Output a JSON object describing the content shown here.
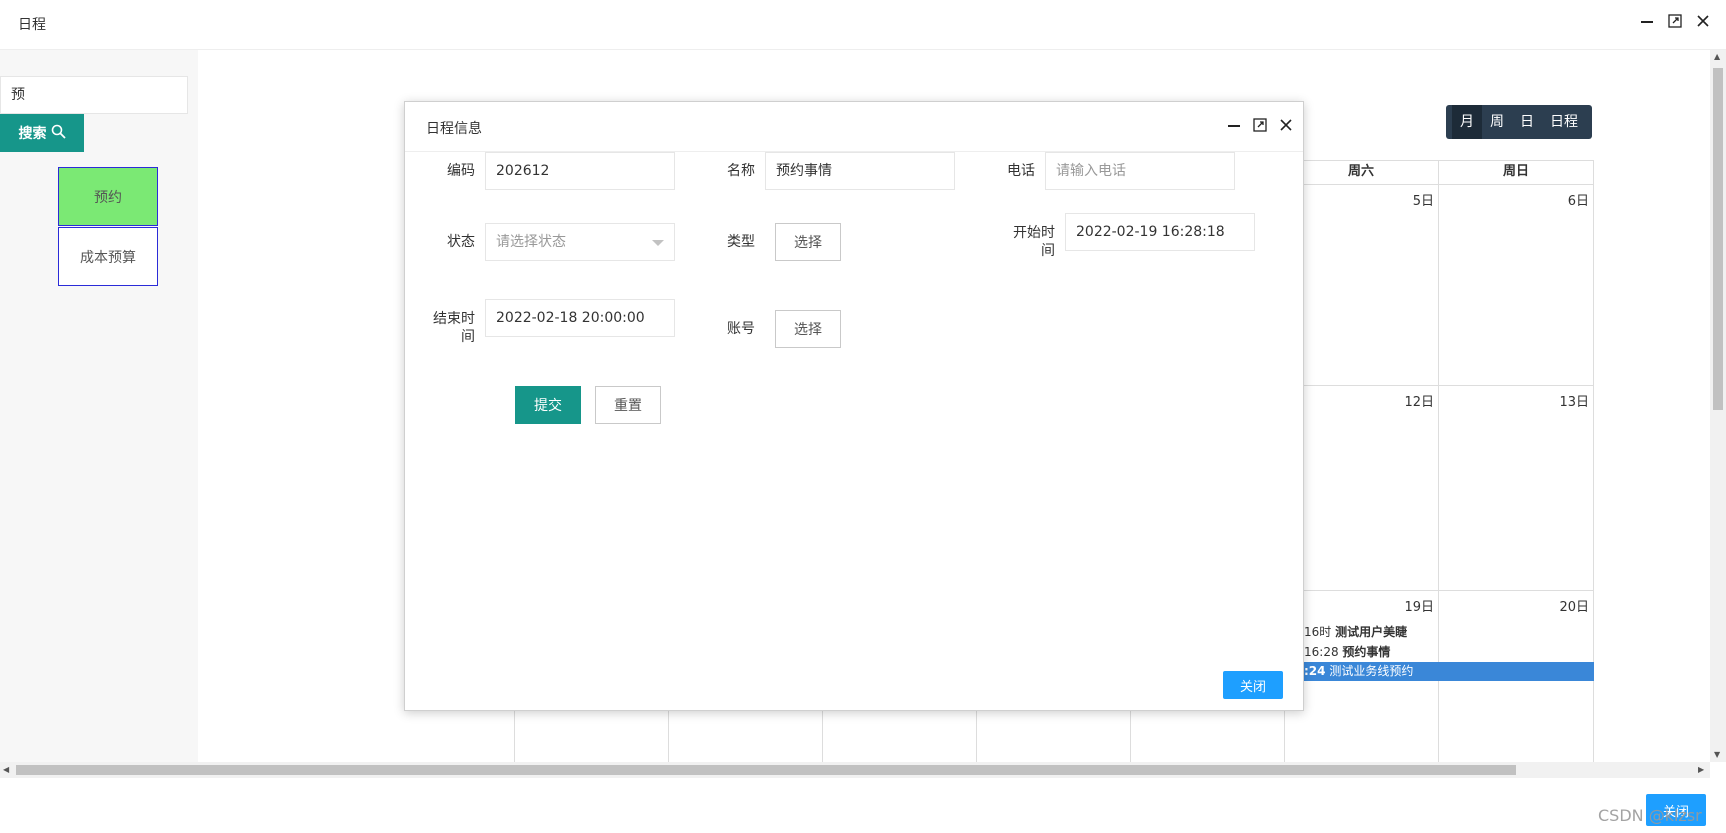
{
  "window": {
    "title": "日程"
  },
  "sidebar": {
    "search_value": "预",
    "search_button": "搜索",
    "categories": [
      {
        "label": "预约"
      },
      {
        "label": "成本预算"
      }
    ]
  },
  "calendar": {
    "views": [
      "月",
      "周",
      "日",
      "日程"
    ],
    "week_headers": [
      "周六",
      "周日"
    ],
    "day_numbers": [
      "5日",
      "6日",
      "12日",
      "13日",
      "19日",
      "20日"
    ],
    "events": [
      {
        "time": "16时",
        "title": "测试用户美睫"
      },
      {
        "time": "16:28",
        "title": "预约事情"
      },
      {
        "time": ":24",
        "title": "测试业务线预约"
      }
    ],
    "colors": {
      "event_bar": "#3a87d8",
      "view_switch": "#2c3e50"
    }
  },
  "dialog": {
    "title": "日程信息",
    "fields": {
      "code": {
        "label": "编码",
        "value": "202612"
      },
      "name": {
        "label": "名称",
        "value": "预约事情"
      },
      "phone": {
        "label": "电话",
        "placeholder": "请输入电话"
      },
      "status": {
        "label": "状态",
        "placeholder": "请选择状态"
      },
      "type": {
        "label": "类型",
        "button": "选择"
      },
      "start_time": {
        "label": "开始时间",
        "value": "2022-02-19 16:28:18"
      },
      "end_time": {
        "label": "结束时间",
        "value": "2022-02-18 20:00:00"
      },
      "account": {
        "label": "账号",
        "button": "选择"
      }
    },
    "submit": "提交",
    "reset": "重置",
    "close": "关闭"
  },
  "footer": {
    "close": "关闭",
    "watermark": "CSDN @klzsr"
  }
}
